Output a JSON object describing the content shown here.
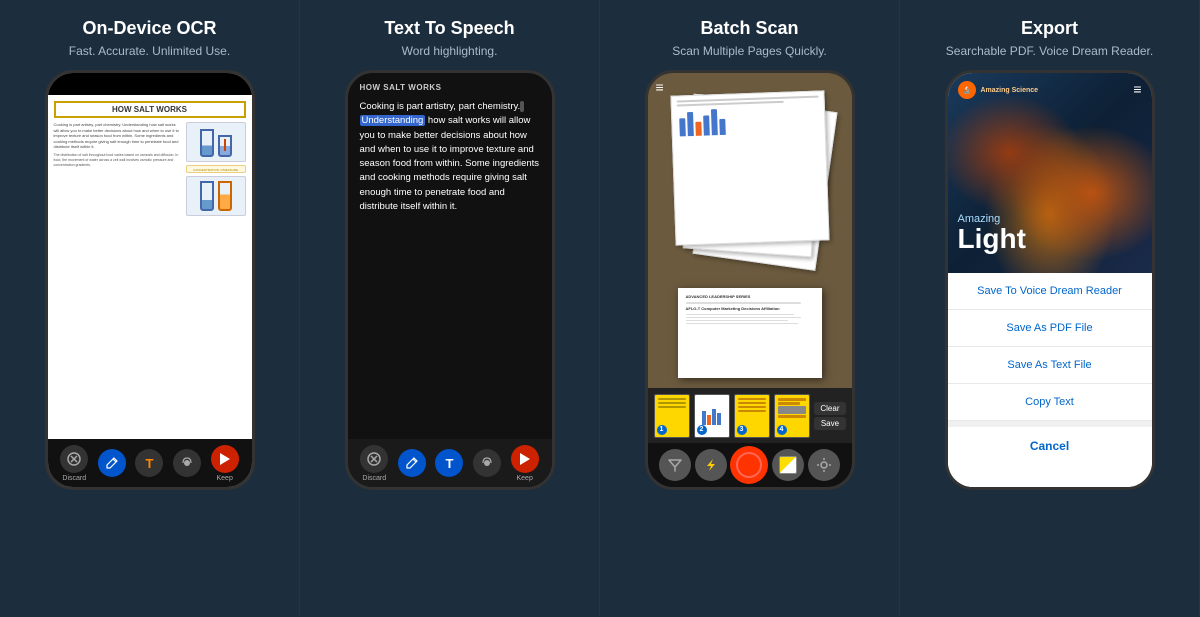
{
  "panels": [
    {
      "id": "ocr",
      "title": "On-Device OCR",
      "subtitle": "Fast. Accurate. Unlimited Use.",
      "doc_title": "HOW SALT WORKS",
      "body_text": "Cooking is part artistry, part chemistry. Understanding how salt works will allow you to make better decisions about how and when to use it to improve texture and season food from within. Some ingredients and cooking methods require giving salt enough time to penetrate food and distribute itself within it.",
      "footer": {
        "discard": "Discard",
        "keep": "Keep"
      }
    },
    {
      "id": "tts",
      "title": "Text To Speech",
      "subtitle": "Word highlighting.",
      "chapter": "HOW SALT WORKS",
      "body": [
        "Cooking is part artistry, part ",
        "chemistry. ",
        "Understanding",
        " how salt works will allow you to make better decisions about how and when to use it to improve texture and season food from within. Some ingredients and cooking methods require giving salt enough time to penetrate food and distribute itself within it."
      ],
      "footer": {
        "discard": "Discard",
        "keep": "Keep"
      }
    },
    {
      "id": "batch",
      "title": "Batch Scan",
      "subtitle": "Scan Multiple Pages Quickly.",
      "clear_btn": "Clear",
      "save_btn": "Save",
      "thumbs": [
        {
          "num": "1"
        },
        {
          "num": "2"
        },
        {
          "num": "3"
        },
        {
          "num": "4"
        }
      ]
    },
    {
      "id": "export",
      "title": "Export",
      "subtitle": "Searchable PDF. Voice Dream Reader.",
      "series_label": "Amazing Science",
      "book_title_line1": "Amazing",
      "book_title_line2": "Light",
      "actions": [
        "Save To Voice Dream Reader",
        "Save As PDF File",
        "Save As Text File",
        "Copy Text"
      ],
      "cancel_label": "Cancel"
    }
  ]
}
